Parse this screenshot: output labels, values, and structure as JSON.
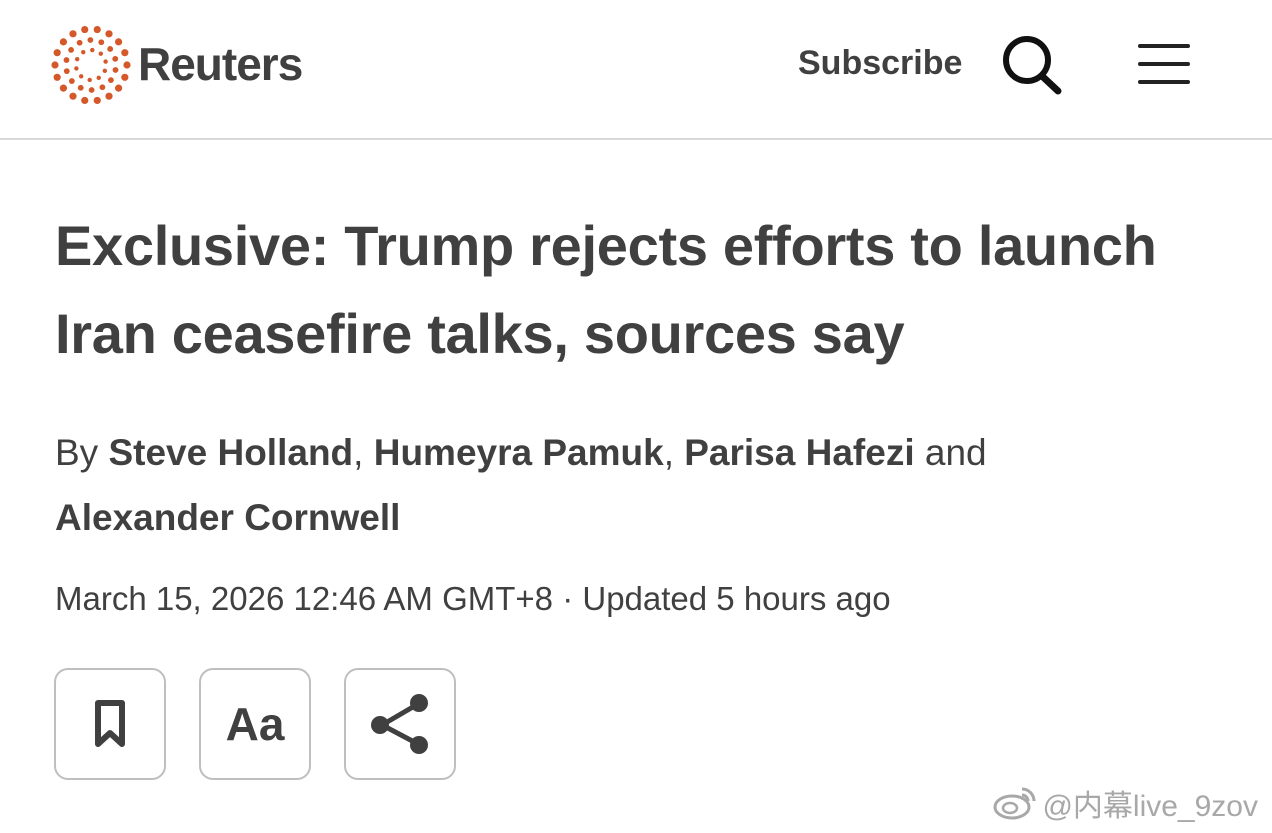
{
  "header": {
    "brand": "Reuters",
    "subscribe_label": "Subscribe",
    "search_icon": "search-icon",
    "menu_icon": "hamburger-menu-icon",
    "brand_color": "#d4582a"
  },
  "article": {
    "headline_line1": "Exclusive: Trump rejects efforts to launch",
    "headline_line2": "Iran ceasefire talks, sources say",
    "byline": {
      "prefix": "By",
      "authors": [
        "Steve Holland",
        "Humeyra Pamuk",
        "Parisa Hafezi",
        "Alexander Cornwell"
      ],
      "separator": ",",
      "conjunction": "and"
    },
    "date": "March 15, 2026 12:46 AM GMT+8",
    "date_separator": "·",
    "updated": "Updated 5 hours ago"
  },
  "tools": {
    "bookmark_icon": "bookmark-icon",
    "text_size_label": "Aa",
    "share_icon": "share-icon"
  },
  "watermark": {
    "text": "@内幕live_9zov",
    "icon": "weibo-icon"
  }
}
